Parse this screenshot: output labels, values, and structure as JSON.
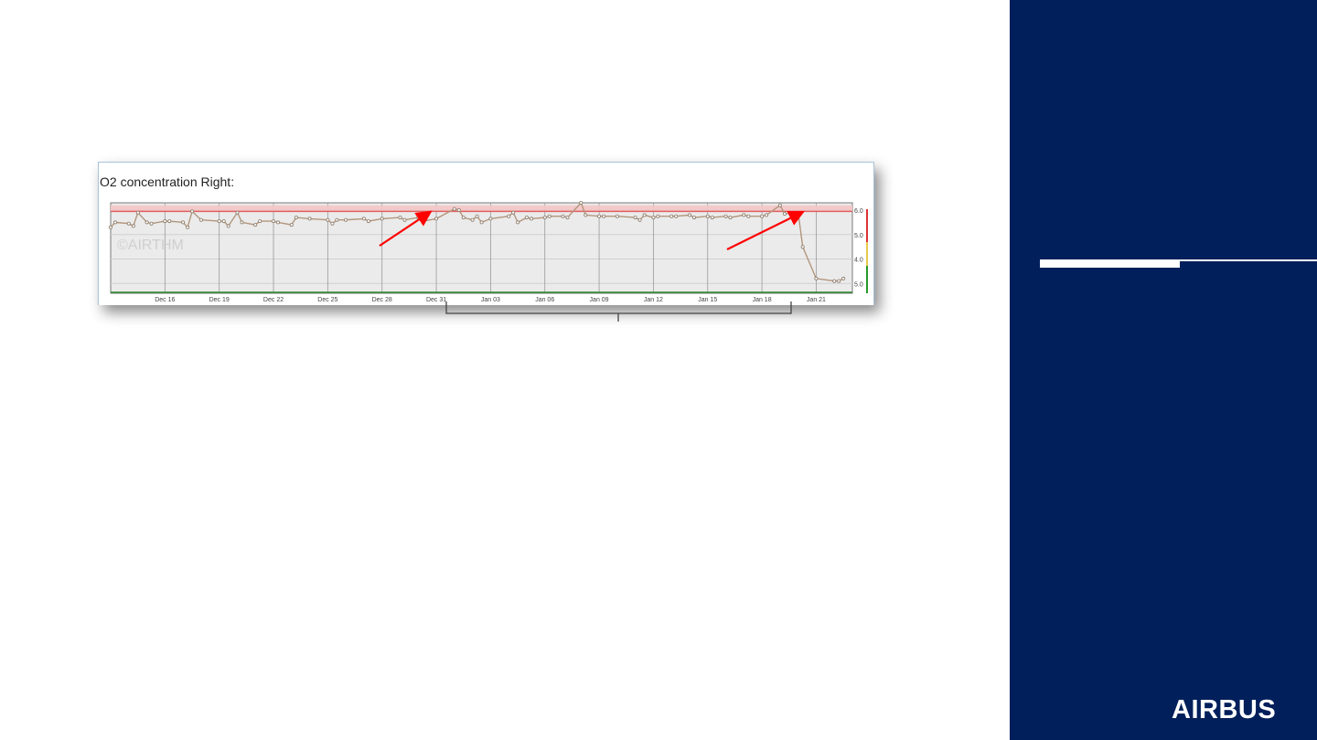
{
  "colors": {
    "sidebar": "#001f5b",
    "trace": "#b3967c",
    "limit_band": "#f4c6c6",
    "limit_line": "#e06060",
    "arrow": "#ff0000",
    "plot_bg": "#ebebeb"
  },
  "logo": {
    "text": "AIRBUS"
  },
  "chart_data": {
    "type": "line",
    "title": "O2 concentration Right:",
    "watermark": "©AIRTHM",
    "x_tick_labels": [
      "Dec 16",
      "Dec 19",
      "Dec 22",
      "Dec 25",
      "Dec 28",
      "Dec 31",
      "Jan 03",
      "Jan 06",
      "Jan 09",
      "Jan 12",
      "Jan 15",
      "Jan 18",
      "Jan 21"
    ],
    "xlim": [
      "2019-12-13",
      "2020-01-23"
    ],
    "y_tick_labels": [
      "6.0",
      "5.0",
      "4.0",
      "5.0"
    ],
    "ylim": [
      2.6,
      6.3
    ],
    "limit_band": [
      5.95,
      6.2
    ],
    "grid": true,
    "series": [
      {
        "values": [
          [
            "2019-12-13",
            5.3
          ],
          [
            "2019-12-13",
            5.5
          ],
          [
            "2019-12-14",
            5.45
          ],
          [
            "2019-12-14",
            5.35
          ],
          [
            "2019-12-14",
            5.9
          ],
          [
            "2019-12-15",
            5.5
          ],
          [
            "2019-12-15",
            5.45
          ],
          [
            "2019-12-16",
            5.55
          ],
          [
            "2019-12-16",
            5.55
          ],
          [
            "2019-12-17",
            5.5
          ],
          [
            "2019-12-17",
            5.3
          ],
          [
            "2019-12-17",
            5.95
          ],
          [
            "2019-12-18",
            5.6
          ],
          [
            "2019-12-19",
            5.55
          ],
          [
            "2019-12-19",
            5.55
          ],
          [
            "2019-12-19",
            5.35
          ],
          [
            "2019-12-20",
            5.9
          ],
          [
            "2019-12-20",
            5.5
          ],
          [
            "2019-12-21",
            5.4
          ],
          [
            "2019-12-21",
            5.55
          ],
          [
            "2019-12-22",
            5.55
          ],
          [
            "2019-12-22",
            5.5
          ],
          [
            "2019-12-23",
            5.4
          ],
          [
            "2019-12-23",
            5.7
          ],
          [
            "2019-12-24",
            5.65
          ],
          [
            "2019-12-25",
            5.6
          ],
          [
            "2019-12-25",
            5.45
          ],
          [
            "2019-12-25",
            5.6
          ],
          [
            "2019-12-26",
            5.6
          ],
          [
            "2019-12-27",
            5.65
          ],
          [
            "2019-12-27",
            5.55
          ],
          [
            "2019-12-28",
            5.65
          ],
          [
            "2019-12-29",
            5.7
          ],
          [
            "2019-12-29",
            5.6
          ],
          [
            "2019-12-30",
            5.7
          ],
          [
            "2019-12-30",
            5.55
          ],
          [
            "2019-12-31",
            5.65
          ],
          [
            "2020-01-01",
            6.05
          ],
          [
            "2020-01-01",
            6.0
          ],
          [
            "2020-01-01",
            5.7
          ],
          [
            "2020-01-02",
            5.6
          ],
          [
            "2020-01-02",
            5.75
          ],
          [
            "2020-01-02",
            5.5
          ],
          [
            "2020-01-03",
            5.65
          ],
          [
            "2020-01-04",
            5.75
          ],
          [
            "2020-01-04",
            5.9
          ],
          [
            "2020-01-04",
            5.5
          ],
          [
            "2020-01-05",
            5.7
          ],
          [
            "2020-01-05",
            5.65
          ],
          [
            "2020-01-06",
            5.7
          ],
          [
            "2020-01-06",
            5.75
          ],
          [
            "2020-01-07",
            5.75
          ],
          [
            "2020-01-07",
            5.7
          ],
          [
            "2020-01-08",
            6.3
          ],
          [
            "2020-01-08",
            5.8
          ],
          [
            "2020-01-09",
            5.75
          ],
          [
            "2020-01-09",
            5.75
          ],
          [
            "2020-01-10",
            5.75
          ],
          [
            "2020-01-11",
            5.7
          ],
          [
            "2020-01-11",
            5.6
          ],
          [
            "2020-01-11",
            5.8
          ],
          [
            "2020-01-12",
            5.7
          ],
          [
            "2020-01-12",
            5.75
          ],
          [
            "2020-01-13",
            5.75
          ],
          [
            "2020-01-13",
            5.75
          ],
          [
            "2020-01-14",
            5.8
          ],
          [
            "2020-01-14",
            5.7
          ],
          [
            "2020-01-15",
            5.75
          ],
          [
            "2020-01-15",
            5.7
          ],
          [
            "2020-01-16",
            5.75
          ],
          [
            "2020-01-16",
            5.7
          ],
          [
            "2020-01-17",
            5.8
          ],
          [
            "2020-01-17",
            5.75
          ],
          [
            "2020-01-18",
            5.75
          ],
          [
            "2020-01-18",
            5.8
          ],
          [
            "2020-01-19",
            6.2
          ],
          [
            "2020-01-19",
            5.85
          ],
          [
            "2020-01-20",
            5.9
          ],
          [
            "2020-01-20",
            4.5
          ],
          [
            "2020-01-21",
            3.2
          ],
          [
            "2020-01-22",
            3.1
          ],
          [
            "2020-01-22",
            3.1
          ],
          [
            "2020-01-22",
            3.2
          ]
        ]
      }
    ]
  }
}
